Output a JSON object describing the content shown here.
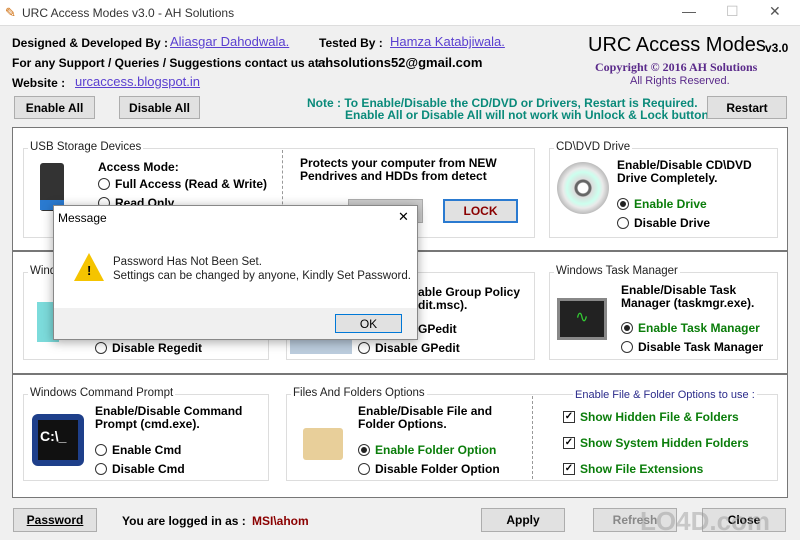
{
  "window": {
    "title": "URC Access Modes v3.0 - AH Solutions",
    "minimize": "—",
    "maximize": "☐",
    "close": "✕"
  },
  "header": {
    "designed_label": "Designed & Developed By :",
    "designer": "Aliasgar Dahodwala.",
    "tested_label": "Tested By :",
    "tester": "Hamza Katabjiwala.",
    "support_label": "For any Support / Queries / Suggestions contact us at :",
    "email": "ahsolutions52@gmail.com",
    "website_label": "Website :",
    "website": "urcaccess.blogspot.in",
    "app_name": "URC Access Modes",
    "version": "v3.0",
    "copyright": "Copyright © 2016 AH Solutions",
    "rights": "All Rights Reserved."
  },
  "toolbar": {
    "enable_all": "Enable All",
    "disable_all": "Disable All",
    "note_line1": "Note : To Enable/Disable the CD/DVD or Drivers, Restart is Required.",
    "note_line2": "Enable All or Disable All will not work wih Unlock & Lock buttons.",
    "restart": "Restart"
  },
  "usb": {
    "title": "USB Storage Devices",
    "access_mode": "Access Mode:",
    "full_access": "Full Access (Read & Write)",
    "read_only": "Read Only",
    "protect_text": "Protects your computer from NEW Pendrives and HDDs from detect",
    "lock": "LOCK"
  },
  "cd": {
    "title": "CD\\DVD Drive",
    "desc": "Enable/Disable CD\\DVD Drive Completely.",
    "enable": "Enable Drive",
    "disable": "Disable Drive"
  },
  "regedit": {
    "title": "Wind",
    "disable": "Disable Regedit"
  },
  "gpedit": {
    "desc_line1": "able Group Policy",
    "desc_line2": "dit.msc).",
    "enable": "GPedit",
    "disable": "Disable GPedit"
  },
  "taskmgr": {
    "title": "Windows Task Manager",
    "desc": "Enable/Disable Task Manager (taskmgr.exe).",
    "enable": "Enable Task Manager",
    "disable": "Disable Task Manager"
  },
  "cmd": {
    "title": "Windows Command Prompt",
    "desc": "Enable/Disable Command Prompt (cmd.exe).",
    "enable": "Enable Cmd",
    "disable": "Disable Cmd",
    "icon_text": "C:\\_"
  },
  "folders": {
    "title": "Files And Folders Options",
    "desc": "Enable/Disable File and Folder Options.",
    "enable": "Enable Folder Option",
    "disable": "Disable Folder Option",
    "options_title": "Enable File & Folder Options to use :",
    "options": [
      "Show Hidden File & Folders",
      "Show System Hidden Folders",
      "Show File Extensions"
    ]
  },
  "footer": {
    "password": "Password",
    "logged_label": "You are logged in as :",
    "user": "MSI\\ahom",
    "apply": "Apply",
    "refresh": "Refresh",
    "close": "Close"
  },
  "dialog": {
    "title": "Message",
    "line1": "Password Has Not Been Set.",
    "line2": "Settings can be changed by anyone, Kindly Set Password.",
    "ok": "OK",
    "close": "✕"
  },
  "watermark": "LO4D.com"
}
